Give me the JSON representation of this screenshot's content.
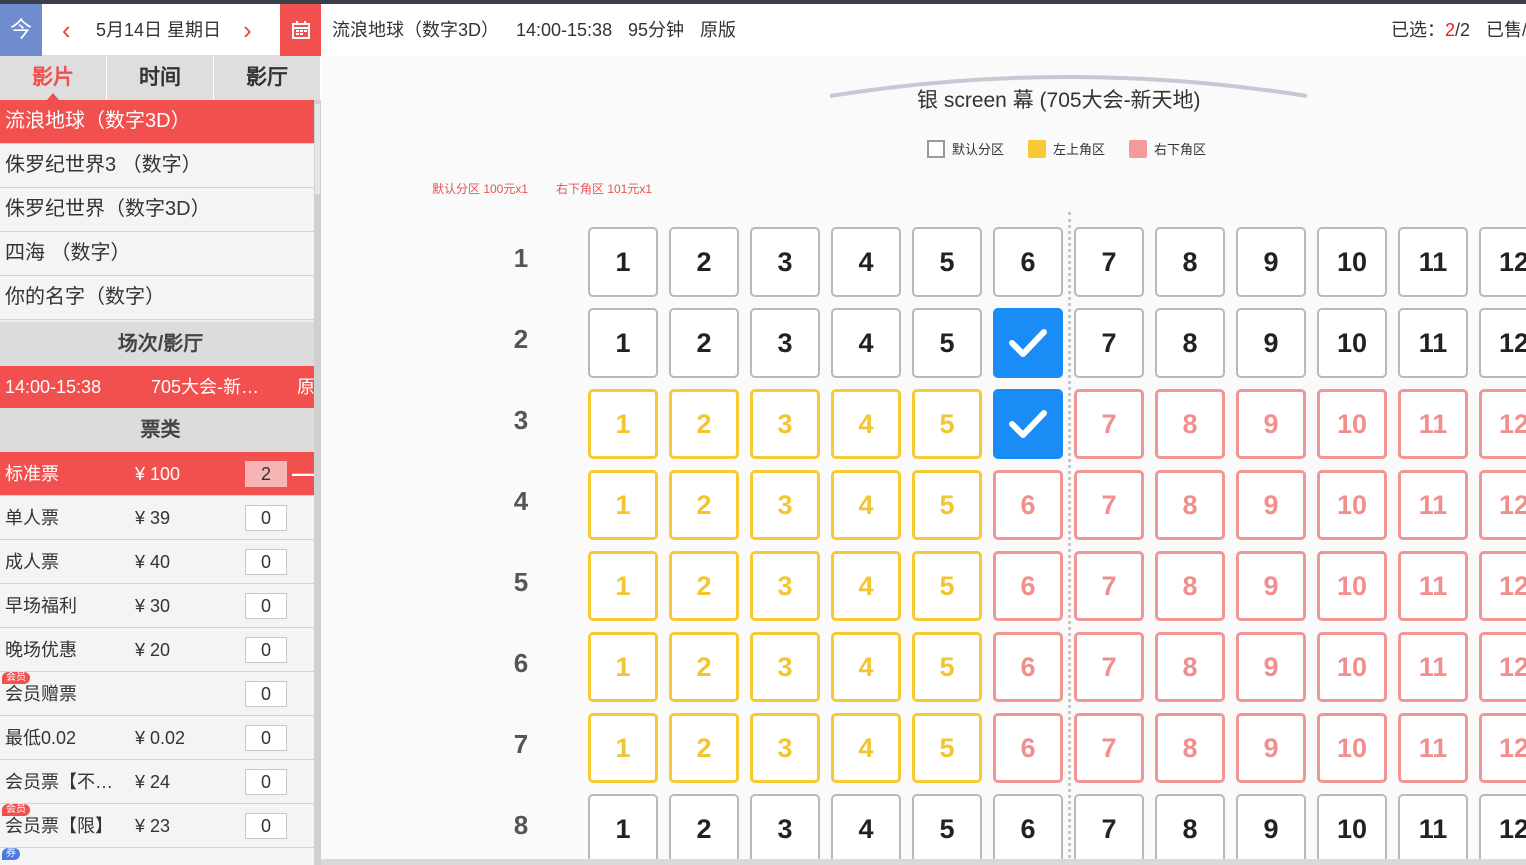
{
  "date_bar": {
    "today": "今",
    "date": "5月14日 星期日"
  },
  "tabs": [
    "影片",
    "时间",
    "影厅"
  ],
  "movies": [
    "流浪地球（数字3D）",
    "侏罗纪世界3 （数字）",
    "侏罗纪世界（数字3D）",
    "四海 （数字）",
    "你的名字（数字）"
  ],
  "showtime_section": "场次/影厅",
  "showtime": {
    "time": "14:00-15:38",
    "hall": "705大会-新…",
    "version": "原"
  },
  "ticket_section": "票类",
  "tickets": [
    {
      "name": "标准票",
      "price": "¥ 100",
      "qty": "2",
      "badge": ""
    },
    {
      "name": "单人票",
      "price": "¥ 39",
      "qty": "0",
      "badge": ""
    },
    {
      "name": "成人票",
      "price": "¥ 40",
      "qty": "0",
      "badge": ""
    },
    {
      "name": "早场福利",
      "price": "¥ 30",
      "qty": "0",
      "badge": ""
    },
    {
      "name": "晚场优惠",
      "price": "¥ 20",
      "qty": "0",
      "badge": ""
    },
    {
      "name": "会员赠票",
      "price": "",
      "qty": "0",
      "badge": "会员"
    },
    {
      "name": "最低0.02",
      "price": "¥ 0.02",
      "qty": "0",
      "badge": ""
    },
    {
      "name": "会员票【不…",
      "price": "¥ 24",
      "qty": "0",
      "badge": ""
    },
    {
      "name": "会员票【限】",
      "price": "¥ 23",
      "qty": "0",
      "badge": "会员"
    }
  ],
  "last_badge": "券",
  "info": {
    "movie": "流浪地球（数字3D）",
    "time": "14:00-15:38",
    "duration": "95分钟",
    "version": "原版",
    "selected_label": "已选：",
    "selected_count": "2",
    "selected_total": "/2",
    "sold_label": "已售/"
  },
  "screen_name": "银 screen 幕 (705大会-新天地)",
  "legend": [
    {
      "label": "默认分区",
      "fill": "#ffffff",
      "border": "#9a9a9a"
    },
    {
      "label": "左上角区",
      "fill": "#f7c934",
      "border": "#f7c934"
    },
    {
      "label": "右下角区",
      "fill": "#f59a9a",
      "border": "#f59a9a"
    }
  ],
  "zone_prices": [
    "默认分区 100元x1",
    "右下角区 101元x1"
  ],
  "seat_rows": [
    {
      "label": "1",
      "seats": [
        "d",
        "d",
        "d",
        "d",
        "d",
        "d",
        "d",
        "d",
        "d",
        "d",
        "d",
        "d"
      ]
    },
    {
      "label": "2",
      "seats": [
        "d",
        "d",
        "d",
        "d",
        "d",
        "sel",
        "d",
        "d",
        "d",
        "d",
        "d",
        "d"
      ]
    },
    {
      "label": "3",
      "seats": [
        "y",
        "y",
        "y",
        "y",
        "y",
        "sel",
        "p",
        "p",
        "p",
        "p",
        "p",
        "p"
      ]
    },
    {
      "label": "4",
      "seats": [
        "y",
        "y",
        "y",
        "y",
        "y",
        "p",
        "p",
        "p",
        "p",
        "p",
        "p",
        "p"
      ]
    },
    {
      "label": "5",
      "seats": [
        "y",
        "y",
        "y",
        "y",
        "y",
        "p",
        "p",
        "p",
        "p",
        "p",
        "p",
        "p"
      ]
    },
    {
      "label": "6",
      "seats": [
        "y",
        "y",
        "y",
        "y",
        "y",
        "p",
        "p",
        "p",
        "p",
        "p",
        "p",
        "p"
      ]
    },
    {
      "label": "7",
      "seats": [
        "y",
        "y",
        "y",
        "y",
        "y",
        "p",
        "p",
        "p",
        "p",
        "p",
        "p",
        "p"
      ]
    },
    {
      "label": "8",
      "seats": [
        "d",
        "d",
        "d",
        "d",
        "d",
        "d",
        "d",
        "d",
        "d",
        "d",
        "d",
        "d"
      ]
    }
  ],
  "colors": {
    "accent": "#f24f4f",
    "selected": "#1a8cf5",
    "zone_yellow": "#f7c934",
    "zone_pink": "#f29595"
  }
}
